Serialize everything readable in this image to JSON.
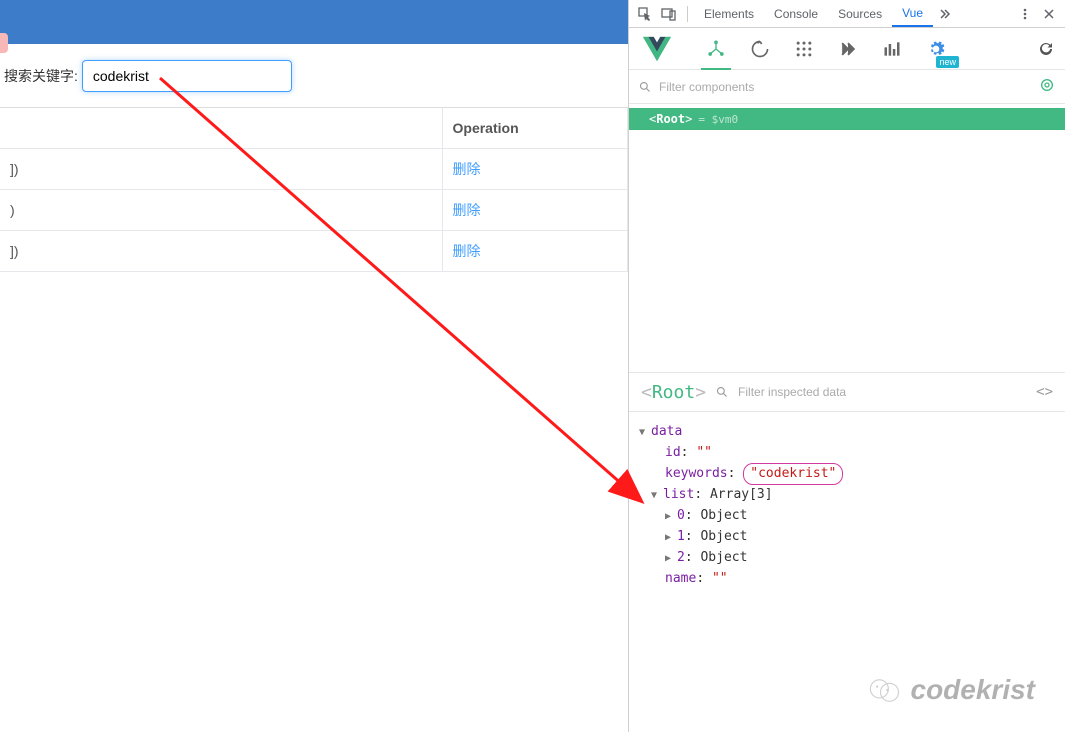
{
  "app": {
    "search_label": "搜索关键字:",
    "search_value": "codekrist",
    "table": {
      "col2_header": "Operation",
      "rows": [
        {
          "c1": "])",
          "op": "删除"
        },
        {
          "c1": ")",
          "op": "删除"
        },
        {
          "c1": "])",
          "op": "删除"
        }
      ]
    }
  },
  "devtools": {
    "tabs": {
      "elements": "Elements",
      "console": "Console",
      "sources": "Sources",
      "vue": "Vue"
    },
    "filter_components_placeholder": "Filter components",
    "root_eq": "= $vm0",
    "root_name": "Root",
    "filter_inspected_placeholder": "Filter inspected data",
    "settings_badge": "new",
    "data_section": {
      "label": "data",
      "id_key": "id",
      "id_val": "\"\"",
      "keywords_key": "keywords",
      "keywords_val": "\"codekrist\"",
      "list_key": "list",
      "list_val": "Array[3]",
      "items": [
        {
          "idx": "0",
          "val": "Object"
        },
        {
          "idx": "1",
          "val": "Object"
        },
        {
          "idx": "2",
          "val": "Object"
        }
      ],
      "name_key": "name",
      "name_val": "\"\""
    }
  },
  "watermark": "codekrist"
}
